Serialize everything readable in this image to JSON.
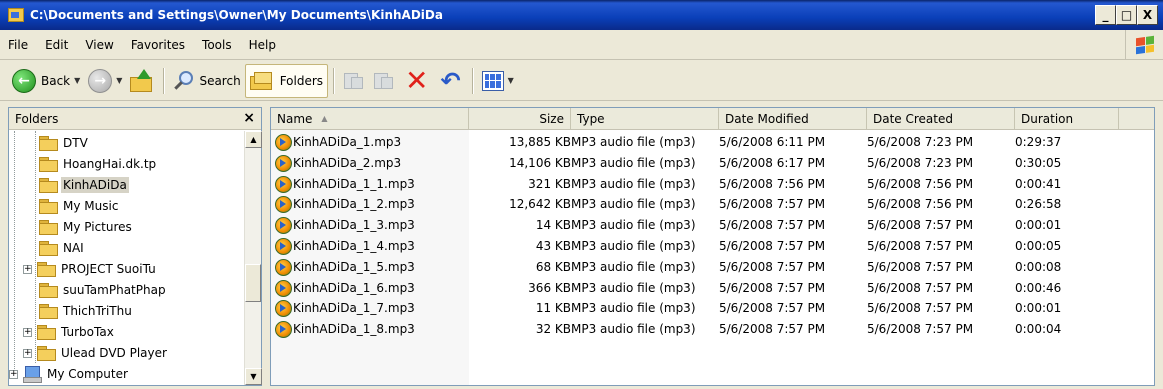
{
  "window": {
    "title": "C:\\Documents and Settings\\Owner\\My Documents\\KinhADiDa",
    "buttons": [
      "_",
      "□",
      "X"
    ]
  },
  "menu": [
    {
      "label": "File"
    },
    {
      "label": "Edit"
    },
    {
      "label": "View"
    },
    {
      "label": "Favorites"
    },
    {
      "label": "Tools"
    },
    {
      "label": "Help"
    }
  ],
  "toolbar": {
    "back_label": "Back",
    "search_label": "Search",
    "folders_label": "Folders"
  },
  "folders_pane": {
    "title": "Folders",
    "close": "×",
    "items": [
      {
        "label": "DTV",
        "icon": "folder-icon"
      },
      {
        "label": "HoangHai.dk.tp",
        "icon": "folder-icon"
      },
      {
        "label": "KinhADiDa",
        "icon": "folder-icon",
        "selected": true
      },
      {
        "label": "My Music",
        "icon": "music-folder-icon"
      },
      {
        "label": "My Pictures",
        "icon": "pictures-folder-icon"
      },
      {
        "label": "NAI",
        "icon": "folder-icon"
      },
      {
        "label": "PROJECT SuoiTu",
        "icon": "folder-icon",
        "expandable": true
      },
      {
        "label": "suuTamPhatPhap",
        "icon": "folder-icon"
      },
      {
        "label": "ThichTriThu",
        "icon": "folder-icon"
      },
      {
        "label": "TurboTax",
        "icon": "folder-icon",
        "expandable": true
      },
      {
        "label": "Ulead DVD Player",
        "icon": "folder-icon",
        "expandable": true
      },
      {
        "label": "My Computer",
        "icon": "computer-icon",
        "expandable": true
      }
    ]
  },
  "file_list": {
    "columns": [
      "Name",
      "Size",
      "Type",
      "Date Modified",
      "Date Created",
      "Duration"
    ],
    "sort_indicator": "▲",
    "rows": [
      {
        "name": "KinhADiDa_1.mp3",
        "size": "13,885 KB",
        "type": "MP3 audio file (mp3)",
        "modified": "5/6/2008 6:11 PM",
        "created": "5/6/2008 7:23 PM",
        "duration": "0:29:37"
      },
      {
        "name": "KinhADiDa_2.mp3",
        "size": "14,106 KB",
        "type": "MP3 audio file (mp3)",
        "modified": "5/6/2008 6:17 PM",
        "created": "5/6/2008 7:23 PM",
        "duration": "0:30:05"
      },
      {
        "name": "KinhADiDa_1_1.mp3",
        "size": "321 KB",
        "type": "MP3 audio file (mp3)",
        "modified": "5/6/2008 7:56 PM",
        "created": "5/6/2008 7:56 PM",
        "duration": "0:00:41"
      },
      {
        "name": "KinhADiDa_1_2.mp3",
        "size": "12,642 KB",
        "type": "MP3 audio file (mp3)",
        "modified": "5/6/2008 7:57 PM",
        "created": "5/6/2008 7:56 PM",
        "duration": "0:26:58"
      },
      {
        "name": "KinhADiDa_1_3.mp3",
        "size": "14 KB",
        "type": "MP3 audio file (mp3)",
        "modified": "5/6/2008 7:57 PM",
        "created": "5/6/2008 7:57 PM",
        "duration": "0:00:01"
      },
      {
        "name": "KinhADiDa_1_4.mp3",
        "size": "43 KB",
        "type": "MP3 audio file (mp3)",
        "modified": "5/6/2008 7:57 PM",
        "created": "5/6/2008 7:57 PM",
        "duration": "0:00:05"
      },
      {
        "name": "KinhADiDa_1_5.mp3",
        "size": "68 KB",
        "type": "MP3 audio file (mp3)",
        "modified": "5/6/2008 7:57 PM",
        "created": "5/6/2008 7:57 PM",
        "duration": "0:00:08"
      },
      {
        "name": "KinhADiDa_1_6.mp3",
        "size": "366 KB",
        "type": "MP3 audio file (mp3)",
        "modified": "5/6/2008 7:57 PM",
        "created": "5/6/2008 7:57 PM",
        "duration": "0:00:46"
      },
      {
        "name": "KinhADiDa_1_7.mp3",
        "size": "11 KB",
        "type": "MP3 audio file (mp3)",
        "modified": "5/6/2008 7:57 PM",
        "created": "5/6/2008 7:57 PM",
        "duration": "0:00:01"
      },
      {
        "name": "KinhADiDa_1_8.mp3",
        "size": "32 KB",
        "type": "MP3 audio file (mp3)",
        "modified": "5/6/2008 7:57 PM",
        "created": "5/6/2008 7:57 PM",
        "duration": "0:00:04"
      }
    ]
  }
}
